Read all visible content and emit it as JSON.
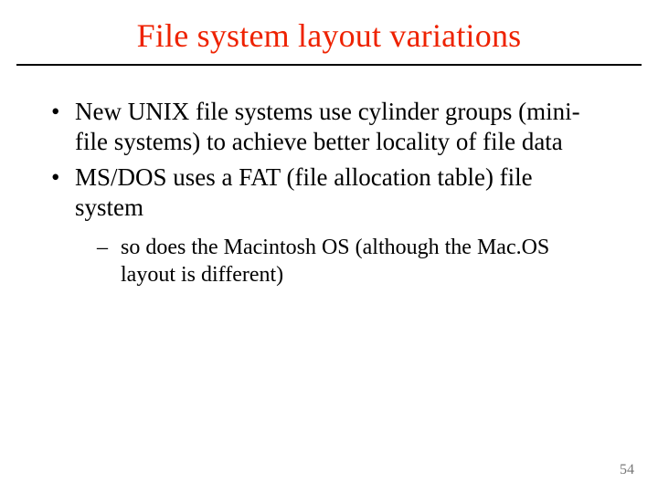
{
  "title": "File system layout variations",
  "bullets": [
    "New UNIX file systems use cylinder groups (mini-file systems) to achieve better locality of file data",
    "MS/DOS uses a FAT (file allocation table) file system"
  ],
  "subbullets": [
    "so does the Macintosh OS (although the Mac.OS layout is different)"
  ],
  "page_number": "54"
}
